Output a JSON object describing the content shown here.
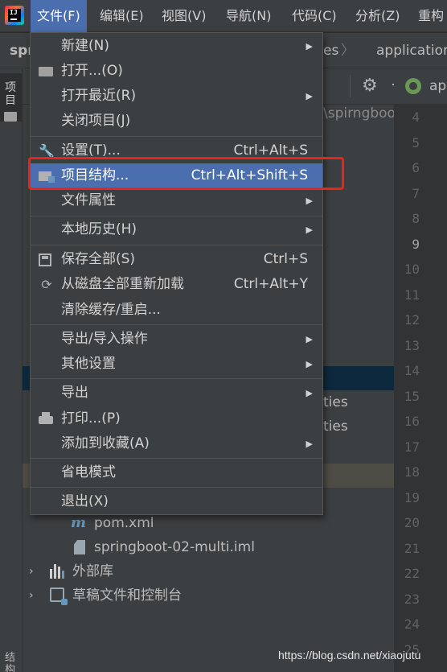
{
  "menubar": {
    "items": [
      "文件(F)",
      "编辑(E)",
      "视图(V)",
      "导航(N)",
      "代码(C)",
      "分析(Z)",
      "重构"
    ],
    "active_index": 0,
    "logo_text": "IJ"
  },
  "navbar": {
    "crumb_left": "spr",
    "crumb_mid": "es",
    "crumb_right": "application"
  },
  "project_panel": {
    "side_tab_label": "项目",
    "side_bottom_label": "结构",
    "path_partial": "\\spirngboo",
    "tree": {
      "ties_1": "ties",
      "ties_2": "ties",
      "pom": "pom.xml",
      "iml": "springboot-02-multi.iml",
      "ext_libs": "外部库",
      "scratches": "草稿文件和控制台"
    }
  },
  "editor": {
    "tab_label": "ap",
    "line_numbers": [
      "4",
      "5",
      "6",
      "7",
      "8",
      "9",
      "10",
      "11",
      "12",
      "13",
      "14",
      "15",
      "16",
      "17",
      "18",
      "19",
      "20",
      "21",
      "22",
      "23",
      "24",
      "25"
    ],
    "current_line": "9"
  },
  "file_menu": {
    "items": [
      {
        "label": "新建(N)",
        "shortcut": "",
        "submenu": true,
        "icon": ""
      },
      {
        "label": "打开...(O)",
        "shortcut": "",
        "submenu": false,
        "icon": "folder-open-icon"
      },
      {
        "label": "打开最近(R)",
        "shortcut": "",
        "submenu": true,
        "icon": ""
      },
      {
        "label": "关闭项目(J)",
        "shortcut": "",
        "submenu": false,
        "icon": ""
      },
      {
        "label": "设置(T)...",
        "shortcut": "Ctrl+Alt+S",
        "submenu": false,
        "icon": "wrench-icon"
      },
      {
        "label": "项目结构...",
        "shortcut": "Ctrl+Alt+Shift+S",
        "submenu": false,
        "icon": "project-structure-icon",
        "highlighted": true
      },
      {
        "label": "文件属性",
        "shortcut": "",
        "submenu": true,
        "icon": ""
      },
      {
        "label": "本地历史(H)",
        "shortcut": "",
        "submenu": true,
        "icon": ""
      },
      {
        "label": "保存全部(S)",
        "shortcut": "Ctrl+S",
        "submenu": false,
        "icon": "save-icon"
      },
      {
        "label": "从磁盘全部重新加载",
        "shortcut": "Ctrl+Alt+Y",
        "submenu": false,
        "icon": "reload-icon"
      },
      {
        "label": "清除缓存/重启...",
        "shortcut": "",
        "submenu": false,
        "icon": ""
      },
      {
        "label": "导出/导入操作",
        "shortcut": "",
        "submenu": true,
        "icon": ""
      },
      {
        "label": "其他设置",
        "shortcut": "",
        "submenu": true,
        "icon": ""
      },
      {
        "label": "导出",
        "shortcut": "",
        "submenu": true,
        "icon": ""
      },
      {
        "label": "打印...(P)",
        "shortcut": "",
        "submenu": false,
        "icon": "print-icon"
      },
      {
        "label": "添加到收藏(A)",
        "shortcut": "",
        "submenu": true,
        "icon": ""
      },
      {
        "label": "省电模式",
        "shortcut": "",
        "submenu": false,
        "icon": ""
      },
      {
        "label": "退出(X)",
        "shortcut": "",
        "submenu": false,
        "icon": ""
      }
    ]
  },
  "watermark": "https://blog.csdn.net/xiaojutu",
  "colors": {
    "highlight": "#4b6eaf",
    "annotation_box": "#e8251c",
    "menu_bg": "#3c3f41",
    "editor_bg": "#2b2b2b"
  }
}
